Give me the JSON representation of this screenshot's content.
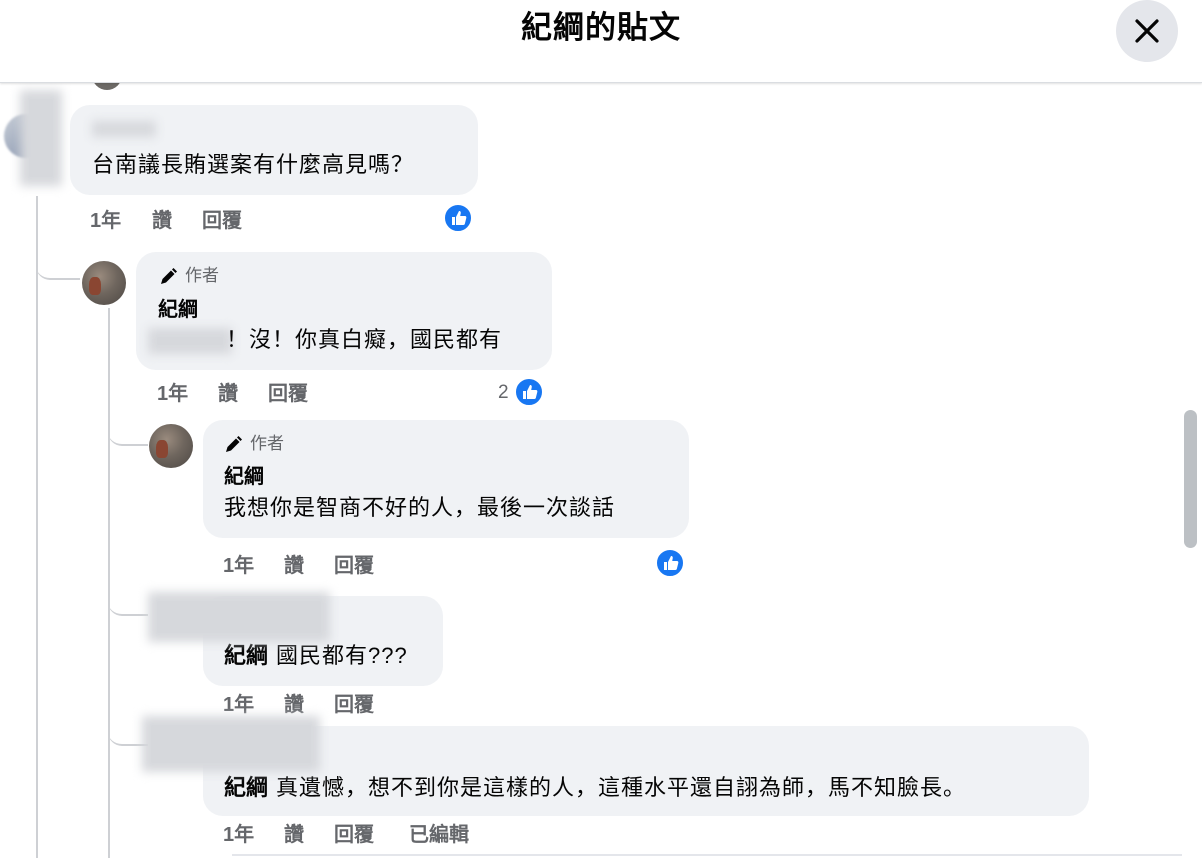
{
  "header": {
    "title": "紀綱的貼文"
  },
  "comments": [
    {
      "text": "台南議長賄選案有什麼高見嗎？",
      "actions": {
        "time": "1年",
        "like": "讚",
        "reply": "回覆"
      }
    },
    {
      "badge": "作者",
      "name": "紀綱",
      "text": "！沒！你真白癡，國民都有",
      "actions": {
        "time": "1年",
        "like": "讚",
        "reply": "回覆"
      },
      "like_count": "2"
    },
    {
      "badge": "作者",
      "name": "紀綱",
      "text": "我想你是智商不好的人，最後一次談話",
      "actions": {
        "time": "1年",
        "like": "讚",
        "reply": "回覆"
      }
    },
    {
      "mention": "紀綱",
      "text": "國民都有???",
      "actions": {
        "time": "1年",
        "like": "讚",
        "reply": "回覆"
      }
    },
    {
      "mention": "紀綱",
      "text": "真遺憾，想不到你是這樣的人，這種水平還自詡為師，馬不知臉長。",
      "actions": {
        "time": "1年",
        "like": "讚",
        "reply": "回覆",
        "edited": "已編輯"
      }
    }
  ],
  "icons": {
    "close": "close-icon",
    "like": "thumbs-up-icon",
    "author": "pencil-icon"
  },
  "colors": {
    "like_blue": "#1877f2",
    "bubble_bg": "#f0f2f5",
    "secondary_text": "#65676b"
  }
}
